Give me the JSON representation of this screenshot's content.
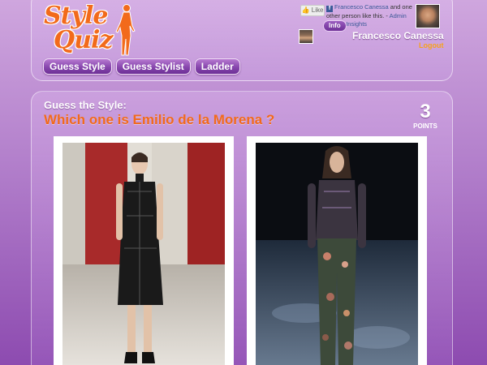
{
  "header": {
    "logo_line1": "Style",
    "logo_line2": "Quiz",
    "nav": [
      "Guess Style",
      "Guess Stylist",
      "Ladder"
    ],
    "like_label": "Like",
    "facebook": {
      "name_link": "Francesco Canessa",
      "text": "and one other person like this.",
      "admin_link": "Admin Page",
      "insights_link": "Insights"
    },
    "info_label": "Info",
    "username": "Francesco Canessa",
    "logout_label": "Logout"
  },
  "quiz": {
    "label": "Guess the Style:",
    "question": "Which one is Emilio de la Morena ?",
    "points_value": "3",
    "points_label": "POINTS"
  },
  "colors": {
    "accent_orange": "#f26a1b",
    "logout_orange": "#f7a21b",
    "button_purple": "#8746ad",
    "facebook_blue": "#3b5998"
  },
  "icons": [
    "style-quiz-logo",
    "thumbs-up-icon",
    "facebook-icon"
  ]
}
